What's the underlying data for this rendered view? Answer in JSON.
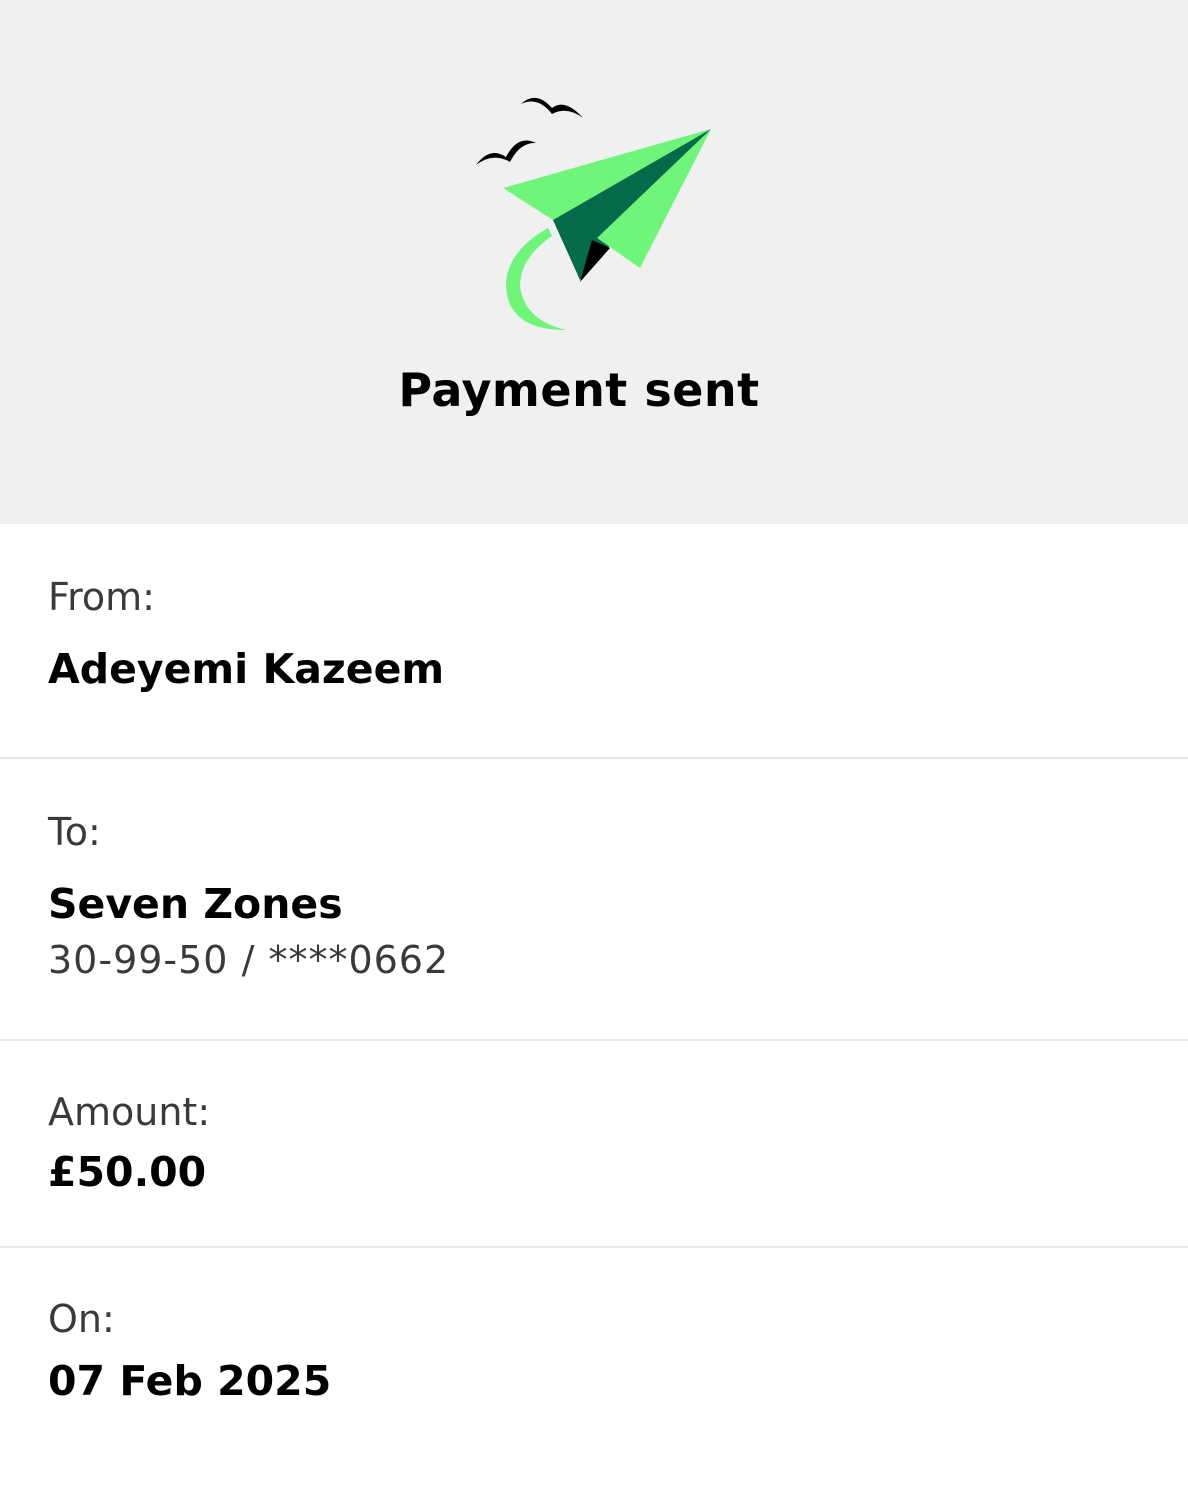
{
  "colors": {
    "hero_background": "#f0f0f0",
    "plane_light_green": "#6ef57a",
    "plane_dark_green": "#046b4a",
    "divider": "#e8e8e8"
  },
  "hero": {
    "icon": "paper-plane-with-birds",
    "title": "Payment sent"
  },
  "details": {
    "from": {
      "label": "From:",
      "name": "Adeyemi Kazeem"
    },
    "to": {
      "label": "To:",
      "name": "Seven Zones",
      "account": "30-99-50 / ****0662"
    },
    "amount": {
      "label": "Amount:",
      "value": "£50.00"
    },
    "date": {
      "label": "On:",
      "value": "07 Feb 2025"
    }
  }
}
